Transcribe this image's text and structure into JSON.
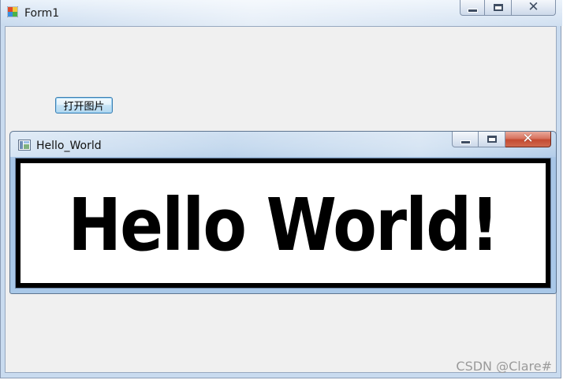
{
  "form1": {
    "title": "Form1",
    "icon": "winforms-app-icon",
    "open_button_label": "打开图片"
  },
  "child_window": {
    "title": "Hello_World",
    "icon": "image-viewer-icon",
    "image_text": "Hello World!"
  },
  "caption_buttons": {
    "minimize_glyph": "—",
    "maximize_glyph": "□",
    "close_glyph": "✕"
  },
  "watermark": "CSDN @Clare#",
  "colors": {
    "client_bg": "#f0f0f0",
    "close_button_red": "#c44a31",
    "button_blue": "#3c7fb1"
  }
}
